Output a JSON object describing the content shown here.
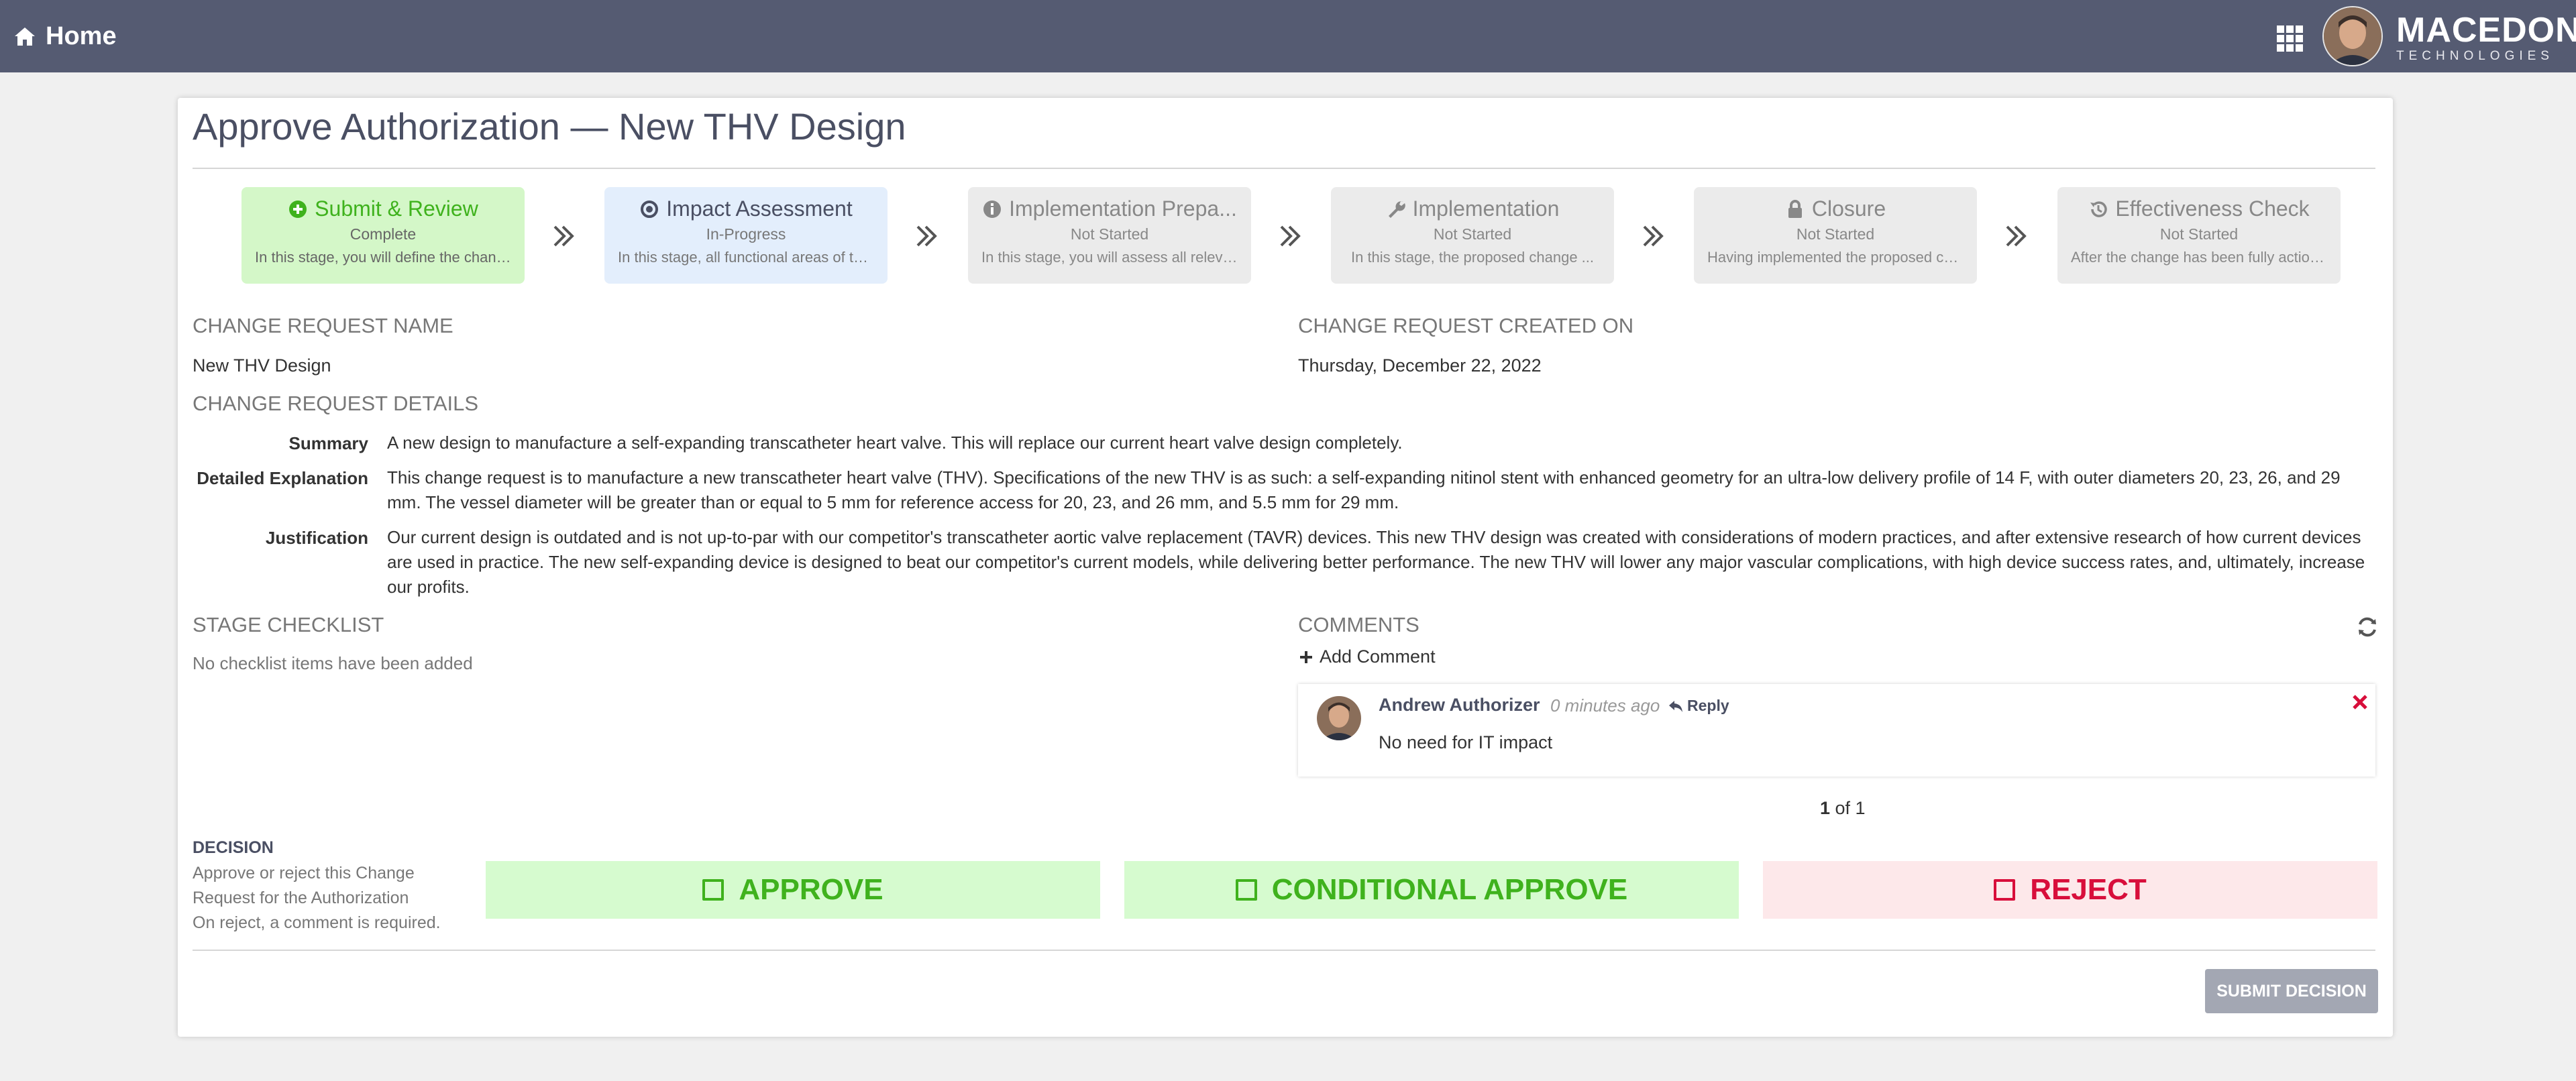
{
  "topbar": {
    "home_label": "Home",
    "brand_name": "MACEDON",
    "brand_sub": "TECHNOLOGIES"
  },
  "page": {
    "title": "Approve Authorization — New THV Design"
  },
  "stages": [
    {
      "title": "Submit & Review",
      "status": "Complete",
      "desc": "In this stage, you will define the change request...",
      "icon": "plus-circle-icon",
      "state": "complete"
    },
    {
      "title": "Impact Assessment",
      "status": "In-Progress",
      "desc": "In this stage, all functional areas of the organization...",
      "icon": "dot-circle-icon",
      "state": "in-progress"
    },
    {
      "title": "Implementation Prepa...",
      "status": "Not Started",
      "desc": "In this stage, you will assess all relevant...",
      "icon": "info-circle-icon",
      "state": "not-started"
    },
    {
      "title": "Implementation",
      "status": "Not Started",
      "desc": "In this stage, the proposed change ...",
      "icon": "wrench-icon",
      "state": "not-started"
    },
    {
      "title": "Closure",
      "status": "Not Started",
      "desc": "Having implemented the proposed change...",
      "icon": "lock-icon",
      "state": "not-started"
    },
    {
      "title": "Effectiveness Check",
      "status": "Not Started",
      "desc": "After the change has been fully actioned...",
      "icon": "history-icon",
      "state": "not-started"
    }
  ],
  "change_request": {
    "name_label": "CHANGE REQUEST NAME",
    "name": "New THV Design",
    "created_label": "CHANGE REQUEST CREATED ON",
    "created": "Thursday, December 22, 2022",
    "details_label": "CHANGE REQUEST DETAILS",
    "summary_key": "Summary",
    "summary": "A new design to manufacture a self-expanding transcatheter heart valve. This will replace our current heart valve design completely.",
    "explanation_key": "Detailed Explanation",
    "explanation": "This change request is to manufacture a new transcatheter heart valve (THV). Specifications of the new THV is as such: a self-expanding nitinol stent with enhanced geometry for an ultra-low delivery profile of 14 F, with outer diameters 20, 23, 26, and 29 mm. The vessel diameter will be greater than or equal to 5 mm for reference access for 20, 23, and 26 mm, and 5.5 mm for 29 mm.",
    "justification_key": "Justification",
    "justification": "Our current design is outdated and is not up-to-par with our competitor's transcatheter aortic valve replacement (TAVR) devices. This new THV design was created with considerations of modern practices, and after extensive research of how current devices are used in practice. The new self-expanding device is designed to beat our competitor's current models, while delivering better performance. The new THV will lower any major vascular complications, with high device success rates, and, ultimately, increase our profits."
  },
  "checklist": {
    "label": "STAGE CHECKLIST",
    "empty": "No checklist items have been added"
  },
  "comments": {
    "label": "COMMENTS",
    "add_label": "Add Comment",
    "items": [
      {
        "author": "Andrew Authorizer",
        "time": "0 minutes ago",
        "reply_label": "Reply",
        "text": "No need for IT impact"
      }
    ],
    "pager_current": "1",
    "pager_rest": " of 1"
  },
  "decision": {
    "heading": "DECISION",
    "desc_line1": "Approve or reject this Change Request for the Authorization",
    "desc_line2": "On reject, a comment is required.",
    "approve": "APPROVE",
    "conditional": "CONDITIONAL APPROVE",
    "reject": "REJECT",
    "submit": "SUBMIT DECISION"
  },
  "colors": {
    "topbar": "#555b72",
    "complete": "#3fb21d",
    "reject": "#d80e3b"
  }
}
